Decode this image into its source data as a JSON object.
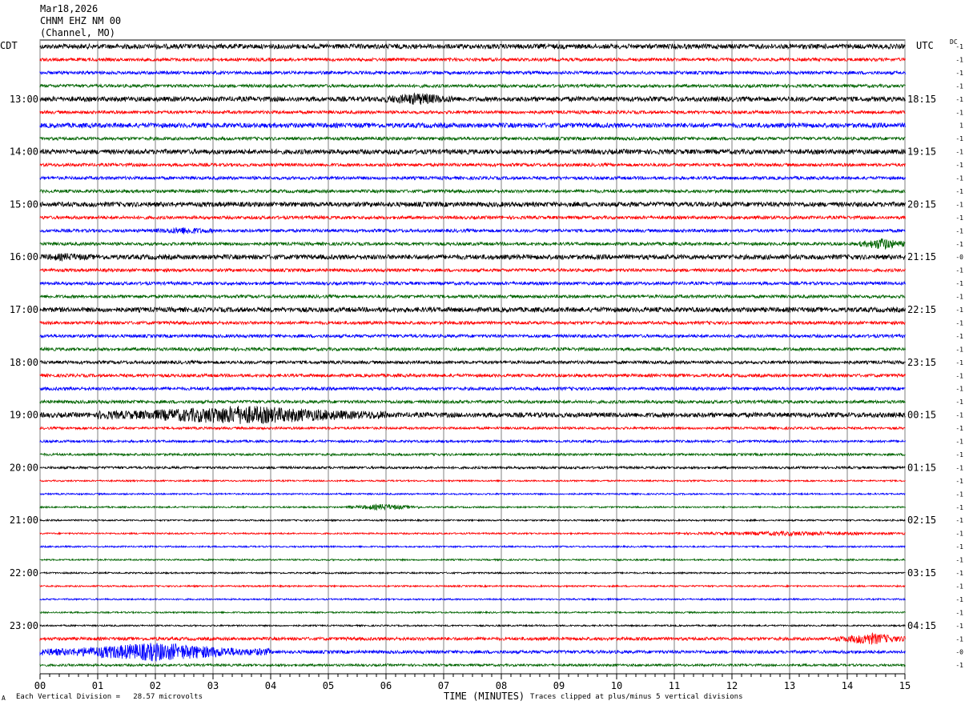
{
  "header": {
    "date": "Mar18,2026",
    "station": "CHNM EHZ NM 00",
    "channel": "(Channel, MO)"
  },
  "left_timezone": "CDT",
  "right_timezone": "UTC",
  "dc_label": "DC",
  "footer": {
    "scale_note": "Each Vertical Division =   28.57 microvolts",
    "xlabel": "TIME (MINUTES)",
    "clip_note": "Traces clipped at plus/minus 5 vertical divisions",
    "corner_mark": "A"
  },
  "colors": {
    "black": "#000000",
    "red": "#ff0000",
    "blue": "#0000ff",
    "green": "#006400",
    "grid": "#808080"
  },
  "chart_data": {
    "type": "helicorder",
    "xlim": [
      0,
      15
    ],
    "x_ticks": [
      "00",
      "01",
      "02",
      "03",
      "04",
      "05",
      "06",
      "07",
      "08",
      "09",
      "10",
      "11",
      "12",
      "13",
      "14",
      "15"
    ],
    "color_cycle": [
      "black",
      "red",
      "blue",
      "green"
    ],
    "rows": 48,
    "left_hour_labels": [
      {
        "row": 4,
        "label": "13:00"
      },
      {
        "row": 8,
        "label": "14:00"
      },
      {
        "row": 12,
        "label": "15:00"
      },
      {
        "row": 16,
        "label": "16:00"
      },
      {
        "row": 20,
        "label": "17:00"
      },
      {
        "row": 24,
        "label": "18:00"
      },
      {
        "row": 28,
        "label": "19:00"
      },
      {
        "row": 32,
        "label": "20:00"
      },
      {
        "row": 36,
        "label": "21:00"
      },
      {
        "row": 40,
        "label": "22:00"
      },
      {
        "row": 44,
        "label": "23:00"
      }
    ],
    "right_hour_labels": [
      {
        "row": 4,
        "label": "18:15"
      },
      {
        "row": 8,
        "label": "19:15"
      },
      {
        "row": 12,
        "label": "20:15"
      },
      {
        "row": 16,
        "label": "21:15"
      },
      {
        "row": 20,
        "label": "22:15"
      },
      {
        "row": 24,
        "label": "23:15"
      },
      {
        "row": 28,
        "label": "00:15"
      },
      {
        "row": 32,
        "label": "01:15"
      },
      {
        "row": 36,
        "label": "02:15"
      },
      {
        "row": 40,
        "label": "03:15"
      },
      {
        "row": 44,
        "label": "04:15"
      }
    ],
    "dc_offsets": [
      "-1",
      "-1",
      "-1",
      "-1",
      "-1",
      "-1",
      "1",
      "-1",
      "-1",
      "-1",
      "-1",
      "-1",
      "-1",
      "-1",
      "-1",
      "-1",
      "-0",
      "-1",
      "-1",
      "-1",
      "-1",
      "-1",
      "-1",
      "-1",
      "-1",
      "-1",
      "-1",
      "-1",
      "-1",
      "-1",
      "-1",
      "-1",
      "-1",
      "-1",
      "-1",
      "-1",
      "-1",
      "-1",
      "-1",
      "-1",
      "-1",
      "-1",
      "-1",
      "-1",
      "-1",
      "-1",
      "-0",
      "-1"
    ],
    "trace_amplitude": [
      3,
      2,
      2,
      2,
      3,
      2,
      3,
      2,
      3,
      2,
      2,
      2,
      3,
      2,
      2,
      2,
      3,
      2,
      2,
      2,
      3,
      2,
      2,
      2,
      2,
      2,
      2,
      2,
      3,
      1.5,
      1.5,
      1.5,
      1.5,
      1,
      1,
      1,
      1,
      1,
      1,
      1,
      1,
      1,
      1,
      1,
      1,
      2,
      2,
      1.5
    ],
    "events": [
      {
        "row": 4,
        "start": 5.9,
        "end": 7.2,
        "amp": 8
      },
      {
        "row": 14,
        "start": 2.0,
        "end": 3.0,
        "amp": 5
      },
      {
        "row": 15,
        "start": 14.2,
        "end": 15.0,
        "amp": 8
      },
      {
        "row": 16,
        "start": 0.0,
        "end": 0.9,
        "amp": 5
      },
      {
        "row": 28,
        "start": 1.0,
        "end": 6.0,
        "amp": 12
      },
      {
        "row": 35,
        "start": 5.3,
        "end": 6.6,
        "amp": 4
      },
      {
        "row": 37,
        "start": 11.0,
        "end": 15.0,
        "amp": 3
      },
      {
        "row": 45,
        "start": 13.8,
        "end": 15.0,
        "amp": 8
      },
      {
        "row": 46,
        "start": 0.0,
        "end": 4.0,
        "amp": 12
      }
    ]
  }
}
